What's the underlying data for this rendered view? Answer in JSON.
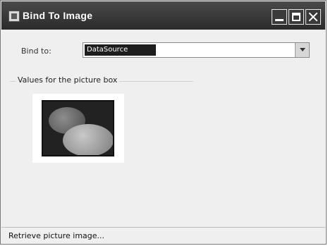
{
  "window": {
    "title": "Bind To Image"
  },
  "form": {
    "bind_label": "Bind to:",
    "binding_selected": "DataSource"
  },
  "group": {
    "title": "Values for the picture box"
  },
  "statusbar": {
    "text": "Retrieve picture image..."
  }
}
